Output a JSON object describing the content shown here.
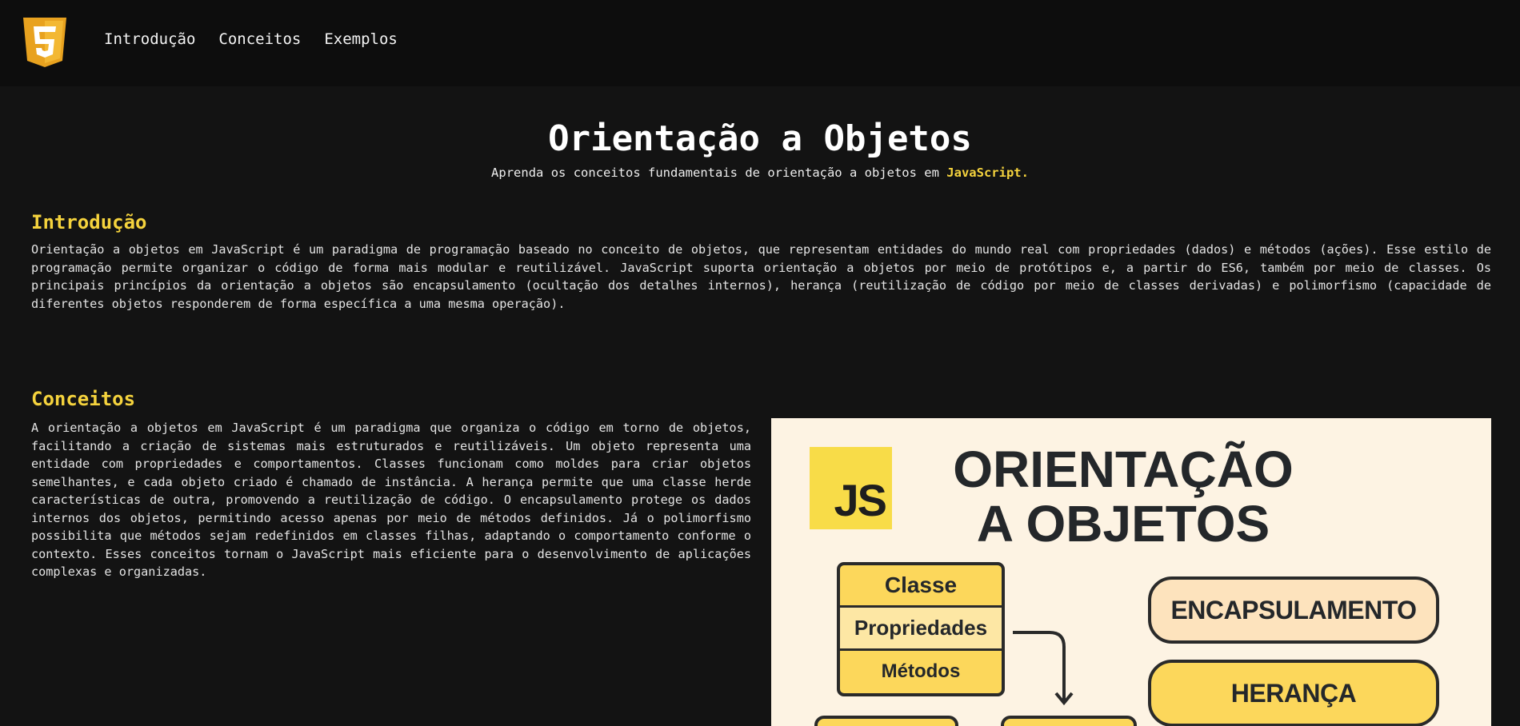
{
  "nav": {
    "logo_icon": "html5-icon",
    "links": [
      "Introdução",
      "Conceitos",
      "Exemplos"
    ]
  },
  "hero": {
    "title": "Orientação a Objetos",
    "subtitle_prefix": "Aprenda os conceitos fundamentais de orientação a objetos em ",
    "subtitle_highlight": "JavaScript."
  },
  "intro": {
    "title": "Introdução",
    "text": "Orientação a objetos em JavaScript é um paradigma de programação baseado no conceito de objetos, que representam entidades do mundo real com propriedades (dados) e métodos (ações). Esse estilo de programação permite organizar o código de forma mais modular e reutilizável. JavaScript suporta orientação a objetos por meio de protótipos e, a partir do ES6, também por meio de classes. Os principais princípios da orientação a objetos são encapsulamento (ocultação dos detalhes internos), herança (reutilização de código por meio de classes derivadas) e polimorfismo (capacidade de diferentes objetos responderem de forma específica a uma mesma operação)."
  },
  "concepts": {
    "title": "Conceitos",
    "text": "A orientação a objetos em JavaScript é um paradigma que organiza o código em torno de objetos, facilitando a criação de sistemas mais estruturados e reutilizáveis. Um objeto representa uma entidade com propriedades e comportamentos. Classes funcionam como moldes para criar objetos semelhantes, e cada objeto criado é chamado de instância. A herança permite que uma classe herde características de outra, promovendo a reutilização de código. O encapsulamento protege os dados internos dos objetos, permitindo acesso apenas por meio de métodos definidos. Já o polimorfismo possibilita que métodos sejam redefinidos em classes filhas, adaptando o comportamento conforme o contexto. Esses conceitos tornam o JavaScript mais eficiente para o desenvolvimento de aplicações complexas e organizadas.",
    "image": {
      "badge": "JS",
      "title_line1": "ORIENTAÇÃO",
      "title_line2": "A OBJETOS",
      "class_rows": [
        "Classe",
        "Propriedades",
        "Métodos"
      ],
      "pills": [
        "ENCAPSULAMENTO",
        "HERANÇA"
      ],
      "colors": {
        "background": "#fdf3e3",
        "yellow": "#fcd75b",
        "badge": "#f8dc48",
        "ink": "#24272a"
      }
    }
  },
  "colors": {
    "page_bg": "#131313",
    "nav_bg": "#0d0d0d",
    "accent": "#f5d33d"
  }
}
